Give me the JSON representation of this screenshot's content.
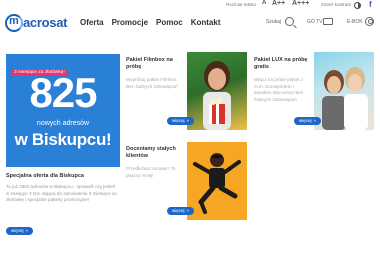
{
  "utility": {
    "font_size_label": "Rozmiar tekstu",
    "font_a1": "A",
    "font_a2": "A++",
    "font_a3": "A+++",
    "contrast_label": "Zmień kontrast",
    "facebook": "f"
  },
  "header": {
    "logo": "acrosat",
    "logo_mark": "m",
    "nav": [
      "Oferta",
      "Promocje",
      "Pomoc",
      "Kontakt"
    ],
    "search_label": "Szukaj",
    "tv_label": "GO TV",
    "ebok_label": "E-BOK"
  },
  "promo_main": {
    "badge": "3 miesiące za złotówkę!",
    "number": "825",
    "subtitle": "nowych adresów",
    "headline": "w Biskupcu!",
    "bg_color": "#2a7fd6",
    "badge_color": "#e8336b"
  },
  "main_card": {
    "title": "Specjalna oferta dla Biskupca",
    "description": "To już 2800 adresów w Biskupcu - sprawdź czy jesteś w zasięgu! 3 tzw. dająca do zamówienia 3 miesiące za złotówkę i specjalne pakiety promocyjne!",
    "button": "więcej"
  },
  "cards": [
    {
      "title": "Pakiet Filmbox na próbę",
      "description": "Wypróbuj pakiet Filmbox. Bez żadnych zobowiązań",
      "button": "więcej"
    },
    {
      "title": "Pakiet LUX na próbę gratis",
      "description": "Włącz na próbę pakiet z m.in. Eurosportem i kanałem Discovery! Bez żadnych zobowiązań",
      "button": "więcej"
    },
    {
      "title": "Doceniamy stałych klientów",
      "description": "Przedłużasz umowę? To płacisz mniej!",
      "button": "więcej"
    }
  ],
  "colors": {
    "brand_blue": "#1e5fb4",
    "button_blue": "#1e66c8",
    "accent_pink": "#e8336b",
    "dance_bg": "#f5a623"
  }
}
